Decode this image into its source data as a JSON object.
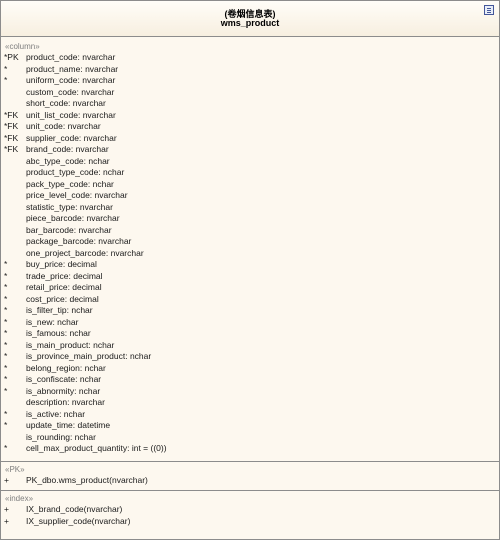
{
  "entity": {
    "stereotype": "(卷烟信息表)",
    "name": "wms_product"
  },
  "columns_section": {
    "label": "«column»",
    "rows": [
      {
        "flag": "*PK",
        "text": "product_code:  nvarchar"
      },
      {
        "flag": "*",
        "text": "product_name:  nvarchar"
      },
      {
        "flag": "*",
        "text": "uniform_code:  nvarchar"
      },
      {
        "flag": "",
        "text": "custom_code:  nvarchar"
      },
      {
        "flag": "",
        "text": "short_code:  nvarchar"
      },
      {
        "flag": "*FK",
        "text": "unit_list_code:  nvarchar"
      },
      {
        "flag": "*FK",
        "text": "unit_code:  nvarchar"
      },
      {
        "flag": "*FK",
        "text": "supplier_code:  nvarchar"
      },
      {
        "flag": "*FK",
        "text": "brand_code:  nvarchar"
      },
      {
        "flag": "",
        "text": "abc_type_code:  nchar"
      },
      {
        "flag": "",
        "text": "product_type_code:  nchar"
      },
      {
        "flag": "",
        "text": "pack_type_code:  nchar"
      },
      {
        "flag": "",
        "text": "price_level_code:  nvarchar"
      },
      {
        "flag": "",
        "text": "statistic_type:  nvarchar"
      },
      {
        "flag": "",
        "text": "piece_barcode:  nvarchar"
      },
      {
        "flag": "",
        "text": "bar_barcode:  nvarchar"
      },
      {
        "flag": "",
        "text": "package_barcode:  nvarchar"
      },
      {
        "flag": "",
        "text": "one_project_barcode:  nvarchar"
      },
      {
        "flag": "*",
        "text": "buy_price:  decimal"
      },
      {
        "flag": "*",
        "text": "trade_price:  decimal"
      },
      {
        "flag": "*",
        "text": "retail_price:  decimal"
      },
      {
        "flag": "*",
        "text": "cost_price:  decimal"
      },
      {
        "flag": "*",
        "text": "is_filter_tip:  nchar"
      },
      {
        "flag": "*",
        "text": "is_new:  nchar"
      },
      {
        "flag": "*",
        "text": "is_famous:  nchar"
      },
      {
        "flag": "*",
        "text": "is_main_product:  nchar"
      },
      {
        "flag": "*",
        "text": "is_province_main_product:  nchar"
      },
      {
        "flag": "*",
        "text": "belong_region:  nchar"
      },
      {
        "flag": "*",
        "text": "is_confiscate:  nchar"
      },
      {
        "flag": "*",
        "text": "is_abnormity:  nchar"
      },
      {
        "flag": "",
        "text": "description:  nvarchar"
      },
      {
        "flag": "*",
        "text": "is_active:  nchar"
      },
      {
        "flag": "*",
        "text": "update_time:  datetime"
      },
      {
        "flag": "",
        "text": "is_rounding:  nchar"
      },
      {
        "flag": "*",
        "text": "cell_max_product_quantity:  int = ((0))"
      }
    ]
  },
  "pk_section": {
    "label": "«PK»",
    "rows": [
      {
        "flag": "+",
        "text": "PK_dbo.wms_product(nvarchar)"
      }
    ]
  },
  "index_section": {
    "label": "«index»",
    "rows": [
      {
        "flag": "+",
        "text": "IX_brand_code(nvarchar)"
      },
      {
        "flag": "+",
        "text": "IX_supplier_code(nvarchar)"
      }
    ]
  },
  "icon": "class-compartment-icon"
}
